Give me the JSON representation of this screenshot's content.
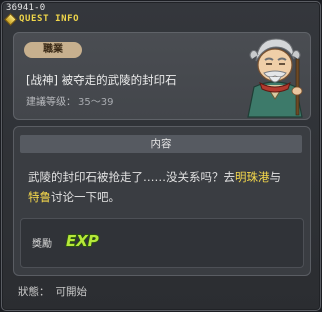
{
  "window": {
    "quest_id": "36941-0",
    "title": "QUEST INFO"
  },
  "quest": {
    "job_label": "職業",
    "name": "[战神] 被夺走的武陵的封印石",
    "level_label": "建議等级：",
    "level_range": "35～39"
  },
  "content": {
    "header": "内容",
    "text_part1": "武陵的封印石被抢走了……没关系吗？去",
    "place1": "明珠港",
    "text_part2": "与",
    "place2": "特鲁",
    "text_part3": "讨论一下吧。"
  },
  "reward": {
    "label": "獎勵",
    "exp_text": "EXP"
  },
  "status": {
    "label": "狀態：",
    "value": "可開始"
  },
  "colors": {
    "highlight": "#f5d84b",
    "badge": "#c7b08e",
    "title": "#f0d64a"
  },
  "icons": [
    "quest-title-icon",
    "npc-portrait",
    "exp-icon"
  ]
}
